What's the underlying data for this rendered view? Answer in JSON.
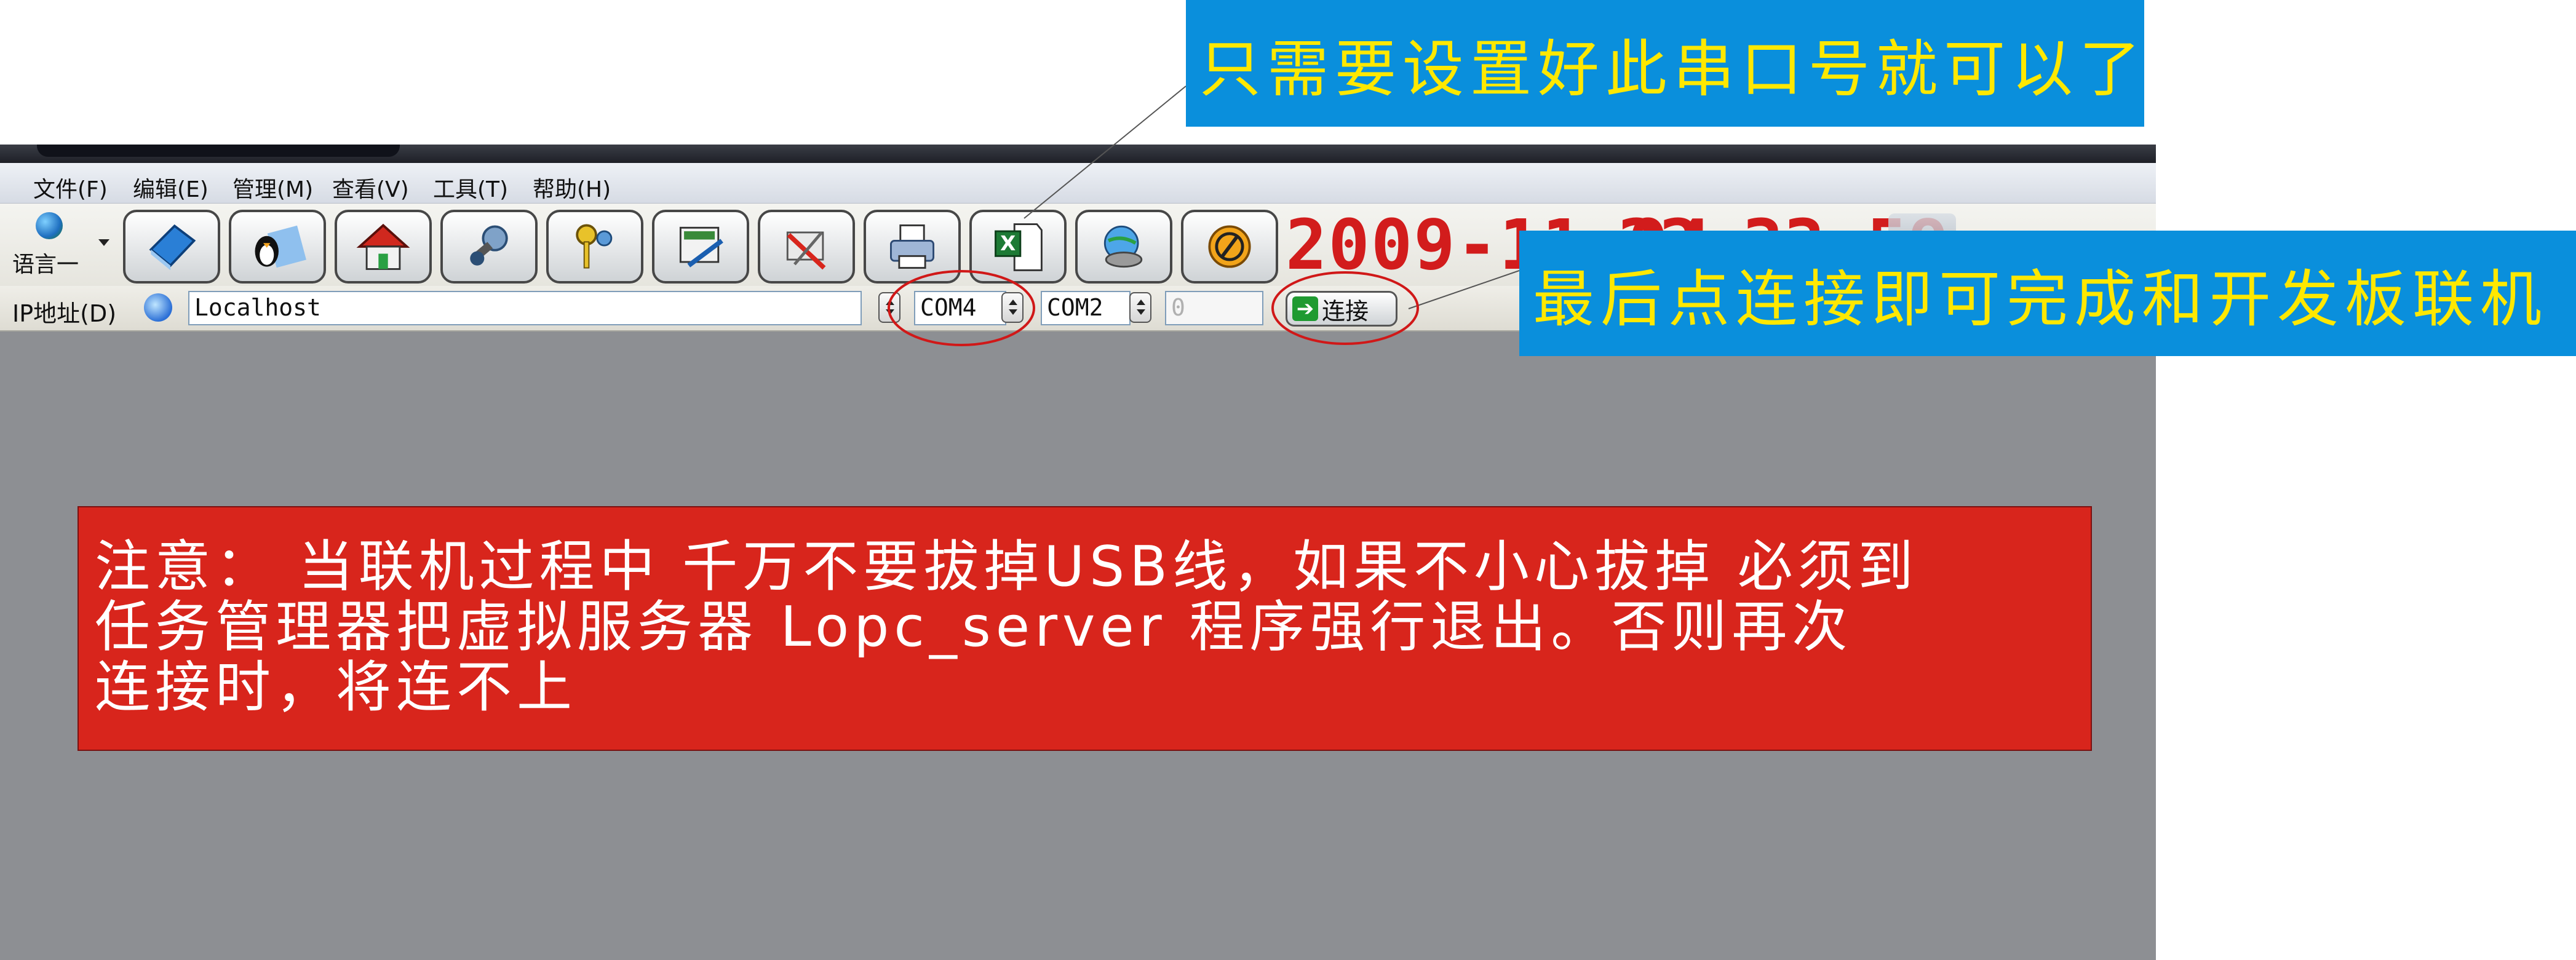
{
  "menu": {
    "items": [
      "文件(F)",
      "编辑(E)",
      "管理(M)",
      "查看(V)",
      "工具(T)",
      "帮助(H)"
    ]
  },
  "toolbar": {
    "language_label": "语言一",
    "clock_date": "2009-11-04",
    "clock_time": "22:33:59"
  },
  "address_bar": {
    "label": "IP地址(D)",
    "ip_value": "Localhost",
    "port_1": "COM4",
    "port_2": "COM2",
    "number_value": "0",
    "connect_label": "连接"
  },
  "annotations": {
    "top_callout": "只需要设置好此串口号就可以了",
    "right_callout": "最后点连接即可完成和开发板联机",
    "warning_lines": [
      "注意： 当联机过程中 千万不要拔掉USB线，如果不小心拔掉 必须到",
      "任务管理器把虚拟服务器 Lopc_server 程序强行退出。否则再次",
      "连接时，将连不上"
    ]
  },
  "colors": {
    "callout_bg": "#0a8fdc",
    "callout_text": "#ffe800",
    "warning_bg": "#d8251c",
    "highlight_ellipse": "#d01818",
    "clock_red": "#d21c1c"
  }
}
